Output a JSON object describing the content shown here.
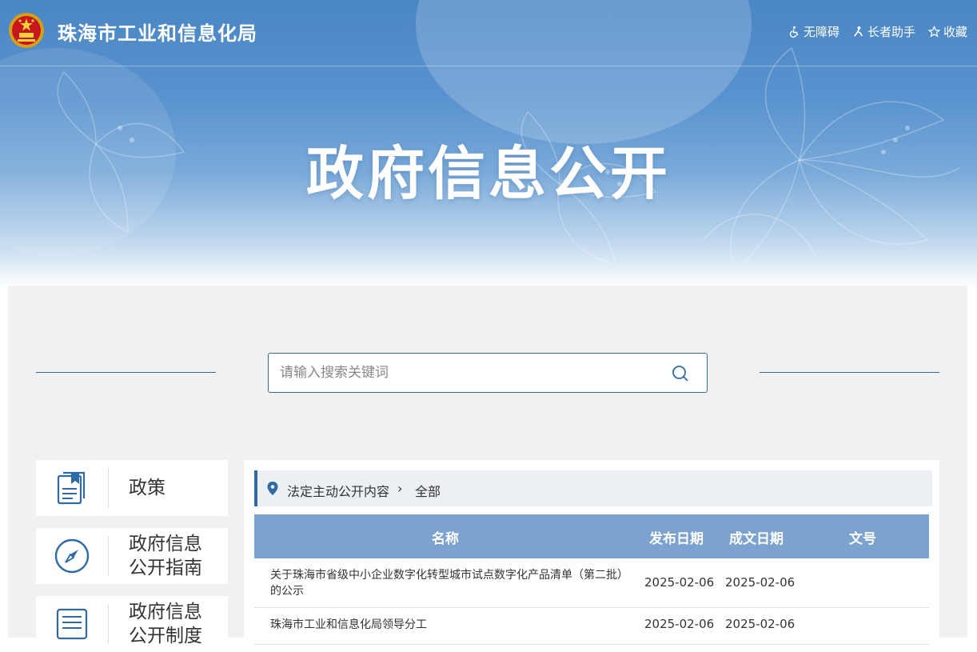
{
  "header": {
    "site_title": "珠海市工业和信息化局",
    "links": [
      {
        "label": "无障碍",
        "icon": "accessibility-icon"
      },
      {
        "label": "长者助手",
        "icon": "elderly-icon"
      },
      {
        "label": "收藏",
        "icon": "star-icon"
      }
    ]
  },
  "hero": {
    "title": "政府信息公开"
  },
  "search": {
    "placeholder": "请输入搜索关键词"
  },
  "sidebar": {
    "items": [
      {
        "label_line1": "政策",
        "label_line2": "",
        "icon": "document-icon"
      },
      {
        "label_line1": "政府信息",
        "label_line2": "公开指南",
        "icon": "compass-icon"
      },
      {
        "label_line1": "政府信息",
        "label_line2": "公开制度",
        "icon": "list-icon"
      }
    ]
  },
  "breadcrumb": {
    "item1": "法定主动公开内容",
    "item2": "全部"
  },
  "table": {
    "headers": {
      "name": "名称",
      "publish_date": "发布日期",
      "doc_date": "成文日期",
      "doc_no": "文号"
    },
    "rows": [
      {
        "name": "关于珠海市省级中小企业数字化转型城市试点数字化产品清单（第二批）的公示",
        "publish_date": "2025-02-06",
        "doc_date": "2025-02-06",
        "doc_no": ""
      },
      {
        "name": "珠海市工业和信息化局领导分工",
        "publish_date": "2025-02-06",
        "doc_date": "2025-02-06",
        "doc_no": ""
      }
    ]
  },
  "colors": {
    "primary": "#2f6aa5",
    "table_header": "#7ca3cf",
    "content_bg": "#f1f1f1"
  }
}
